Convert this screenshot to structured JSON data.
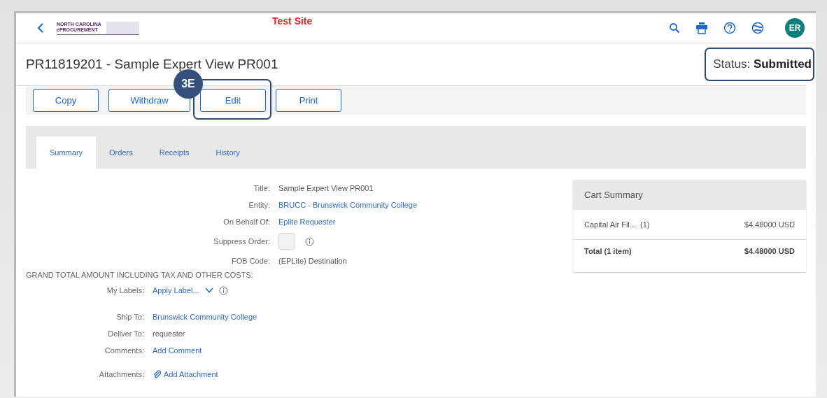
{
  "header": {
    "logo_lines": [
      "NORTH CAROLINA",
      "ePROCUREMENT"
    ],
    "site_label": "Test Site",
    "avatar": "ER"
  },
  "title": "PR11819201 - Sample Expert View PR001",
  "status": {
    "label": "Status:",
    "value": "Submitted",
    "highlighted": true
  },
  "actions": [
    {
      "label": "Copy",
      "highlighted": false
    },
    {
      "label": "Withdraw",
      "highlighted": false
    },
    {
      "label": "Edit",
      "highlighted": true,
      "callout": "3E"
    },
    {
      "label": "Print",
      "highlighted": false
    }
  ],
  "tabs": [
    {
      "label": "Summary",
      "selected": true
    },
    {
      "label": "Orders",
      "selected": false
    },
    {
      "label": "Receipts",
      "selected": false
    },
    {
      "label": "History",
      "selected": false
    }
  ],
  "fields": [
    {
      "label": "Title:",
      "kind": "text",
      "value": "Sample Expert View PR001"
    },
    {
      "label": "Entity:",
      "kind": "link",
      "value": "BRUCC - Brunswick Community College"
    },
    {
      "label": "On Behalf Of:",
      "kind": "link",
      "value": "Eplite Requester"
    },
    {
      "label": "Suppress Order:",
      "kind": "checkbox",
      "checked": false
    },
    {
      "label": "FOB Code:",
      "kind": "text",
      "value": "(EPLite) Destination"
    }
  ],
  "grand_total_label": "GRAND TOTAL AMOUNT INCLUDING TAX AND OTHER COSTS:",
  "details": [
    {
      "label": "My Labels:",
      "kind": "dropdown",
      "value": "Apply Label..."
    },
    {
      "label": "Ship To:",
      "kind": "link",
      "value": "Brunswick Community College"
    },
    {
      "label": "Deliver To:",
      "kind": "text",
      "value": "requester"
    },
    {
      "label": "Comments:",
      "kind": "link",
      "value": "Add Comment"
    },
    {
      "label": "Attachments:",
      "kind": "attachment",
      "value": "Add Attachment"
    }
  ],
  "cart_summary": {
    "title": "Cart Summary",
    "items": [
      {
        "name": "Capital Air Fil...",
        "qty": "(1)",
        "amount": "$4.48000 USD"
      }
    ],
    "total_label": "Total (1 item)",
    "total_amount": "$4.48000 USD"
  }
}
